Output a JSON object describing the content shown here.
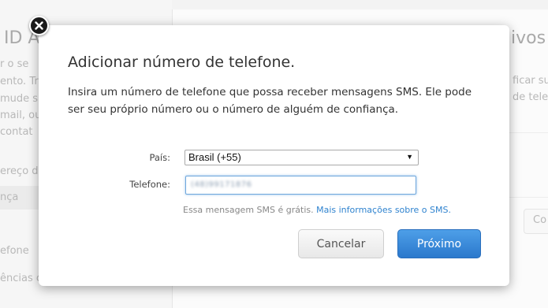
{
  "background": {
    "left_title": "ID A",
    "left_lines": [
      "r o se",
      "ento. Tr",
      "mude s",
      "mail, ou",
      " contat"
    ],
    "left_items": [
      "ereço d",
      "nça",
      "efone",
      "ências c"
    ],
    "right_title": "ivos c",
    "right_lines": [
      "ficar su",
      "de tele"
    ],
    "right_button": "Co"
  },
  "dialog": {
    "title": "Adicionar número de telefone.",
    "description": "Insira um número de telefone que possa receber mensagens SMS. Ele pode ser seu próprio número ou o número de alguém de confiança.",
    "country_label": "País:",
    "country_value": "Brasil (+55)",
    "phone_label": "Telefone:",
    "phone_value": "(48)99171876",
    "sms_note": "Essa mensagem SMS é grátis.",
    "more_info_link": "Mais informações sobre o SMS.",
    "cancel_label": "Cancelar",
    "next_label": "Próximo"
  },
  "colors": {
    "accent": "#2f83cf",
    "primary_button": "#3a8ad9"
  },
  "icons": {
    "close": "close-icon",
    "dropdown": "chevron-down-icon"
  }
}
